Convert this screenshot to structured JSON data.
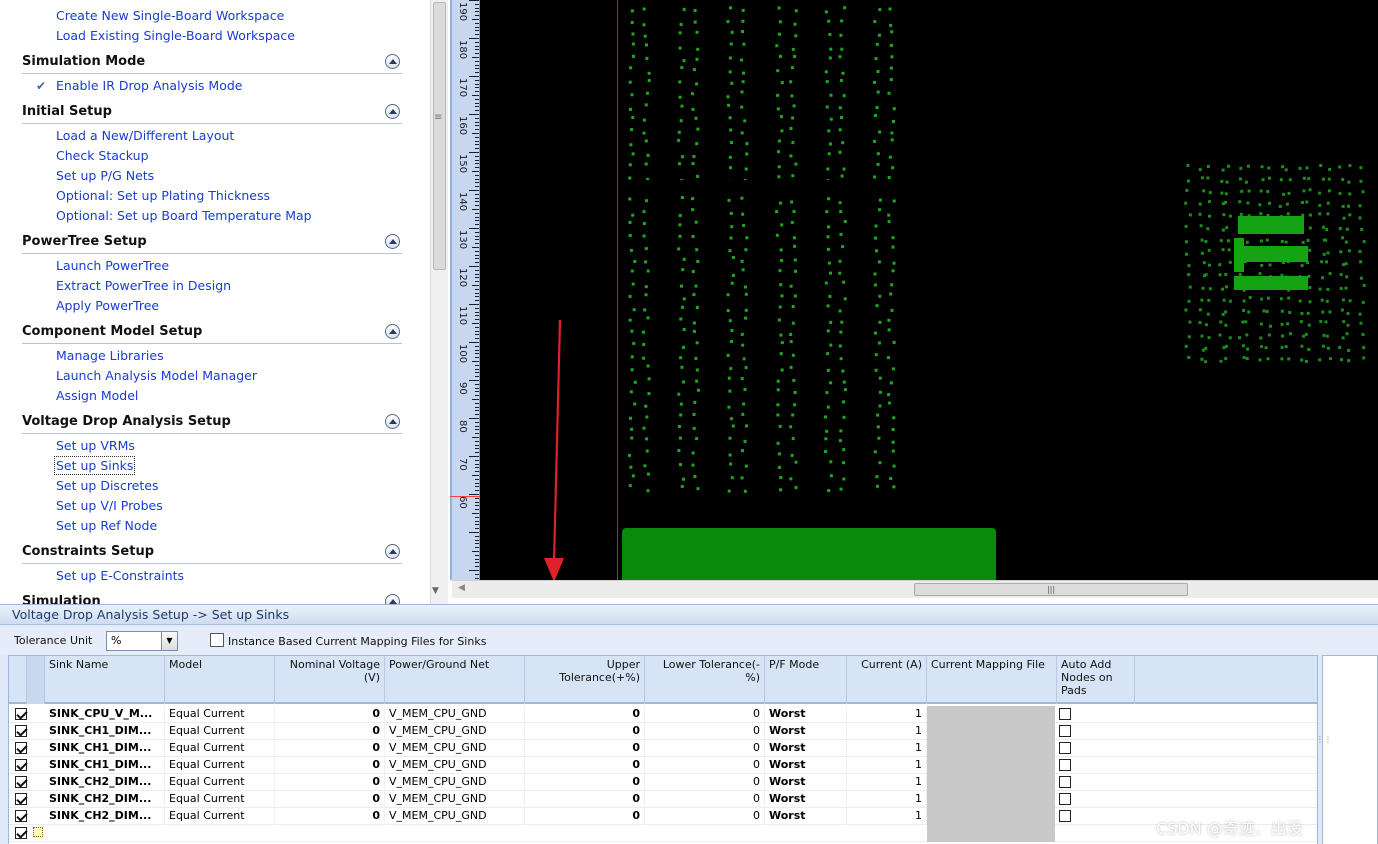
{
  "workflow": {
    "top_links": [
      "Create New Single-Board Workspace",
      "Load Existing Single-Board Workspace"
    ],
    "sections": [
      {
        "title": "Simulation Mode",
        "items": [
          "Enable IR Drop Analysis Mode"
        ]
      },
      {
        "title": "Initial Setup",
        "items": [
          "Load a New/Different Layout",
          "Check Stackup",
          "Set up P/G Nets",
          "Optional: Set up Plating Thickness",
          "Optional: Set up Board Temperature Map"
        ]
      },
      {
        "title": "PowerTree Setup",
        "items": [
          "Launch PowerTree",
          "Extract PowerTree in Design",
          "Apply PowerTree"
        ]
      },
      {
        "title": "Component Model Setup",
        "items": [
          "Manage Libraries",
          "Launch Analysis Model Manager",
          "Assign Model"
        ]
      },
      {
        "title": "Voltage Drop Analysis Setup",
        "items": [
          "Set up VRMs",
          "Set up Sinks",
          "Set up Discretes",
          "Set up V/I Probes",
          "Set up Ref Node"
        ]
      },
      {
        "title": "Constraints Setup",
        "items": [
          "Set up E-Constraints"
        ]
      }
    ],
    "partial_section": "Simulation"
  },
  "ruler": {
    "labels": [
      "190",
      "180",
      "170",
      "160",
      "150",
      "140",
      "130",
      "120",
      "110",
      "100",
      "90",
      "80",
      "70",
      "60"
    ]
  },
  "bottom": {
    "breadcrumb": "Voltage Drop Analysis Setup -> Set up Sinks",
    "tolerance_label": "Tolerance Unit",
    "tolerance_value": "%",
    "instance_label": "Instance Based Current Mapping Files for Sinks",
    "columns": [
      "Sink Name",
      "Model",
      "Nominal Voltage (V)",
      "Power/Ground Net",
      "Upper Tolerance(+%)",
      "Lower Tolerance(-%)",
      "P/F Mode",
      "Current (A)",
      "Current Mapping File",
      "Auto Add Nodes on Pads"
    ],
    "rows": [
      {
        "name": "SINK_CPU_V_M...",
        "model": "Equal Current",
        "voltage": "0",
        "net": "V_MEM_CPU_GND",
        "upper": "0",
        "lower": "0",
        "mode": "Worst",
        "current": "1"
      },
      {
        "name": "SINK_CH1_DIM...",
        "model": "Equal Current",
        "voltage": "0",
        "net": "V_MEM_CPU_GND",
        "upper": "0",
        "lower": "0",
        "mode": "Worst",
        "current": "1"
      },
      {
        "name": "SINK_CH1_DIM...",
        "model": "Equal Current",
        "voltage": "0",
        "net": "V_MEM_CPU_GND",
        "upper": "0",
        "lower": "0",
        "mode": "Worst",
        "current": "1"
      },
      {
        "name": "SINK_CH1_DIM...",
        "model": "Equal Current",
        "voltage": "0",
        "net": "V_MEM_CPU_GND",
        "upper": "0",
        "lower": "0",
        "mode": "Worst",
        "current": "1"
      },
      {
        "name": "SINK_CH2_DIM...",
        "model": "Equal Current",
        "voltage": "0",
        "net": "V_MEM_CPU_GND",
        "upper": "0",
        "lower": "0",
        "mode": "Worst",
        "current": "1"
      },
      {
        "name": "SINK_CH2_DIM...",
        "model": "Equal Current",
        "voltage": "0",
        "net": "V_MEM_CPU_GND",
        "upper": "0",
        "lower": "0",
        "mode": "Worst",
        "current": "1"
      },
      {
        "name": "SINK_CH2_DIM...",
        "model": "Equal Current",
        "voltage": "0",
        "net": "V_MEM_CPU_GND",
        "upper": "0",
        "lower": "0",
        "mode": "Worst",
        "current": "1"
      }
    ]
  },
  "watermark": "CSDN @奇迹、出没",
  "colors": {
    "link": "#1a3cd0",
    "canvas": "#000000",
    "copper": "#0a8a0a",
    "via": "#1fa81f",
    "arrow": "#e0202a",
    "panel": "#dfe9f7"
  }
}
